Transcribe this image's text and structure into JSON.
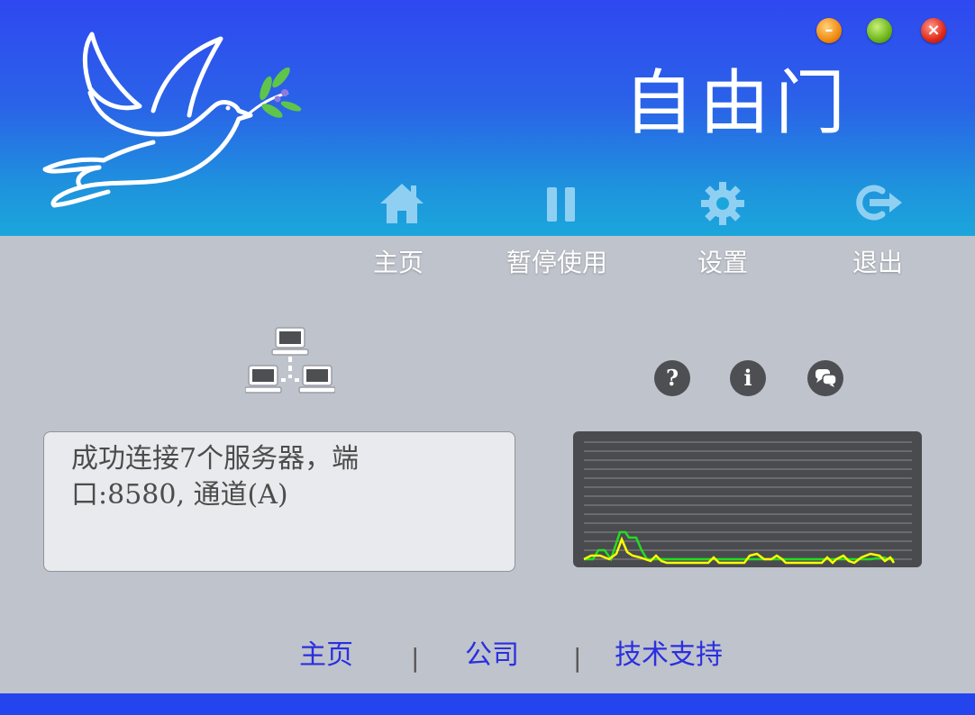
{
  "window": {
    "title": "自由门",
    "controls": {
      "minimize": "–",
      "maximize": "●",
      "close": "×"
    }
  },
  "toolbar": {
    "items": [
      {
        "label": "主页",
        "icon": "home-icon"
      },
      {
        "label": "暂停使用",
        "icon": "pause-icon"
      },
      {
        "label": "设置",
        "icon": "gear-icon"
      },
      {
        "label": "退出",
        "icon": "exit-icon"
      }
    ]
  },
  "status": {
    "text": "成功连接7个服务器，端口:8580, 通道(A)",
    "network_icon": "network-icon"
  },
  "help_icons": [
    {
      "icon": "help-icon",
      "glyph": "?"
    },
    {
      "icon": "info-icon",
      "glyph": "i"
    },
    {
      "icon": "chat-icon",
      "glyph": ""
    }
  ],
  "traffic_graph": {
    "colors": {
      "series1": "#ffff00",
      "series2": "#22dd22",
      "background": "#4a4b4e"
    }
  },
  "footer": {
    "links": [
      "主页",
      "公司",
      "技术支持"
    ],
    "separator": "|"
  },
  "colors": {
    "header_top": "#2f48f0",
    "header_bottom": "#1ba6db",
    "body": "#bfc3cb",
    "link": "#2a2fe0",
    "bottom_bar": "#2444ee"
  }
}
